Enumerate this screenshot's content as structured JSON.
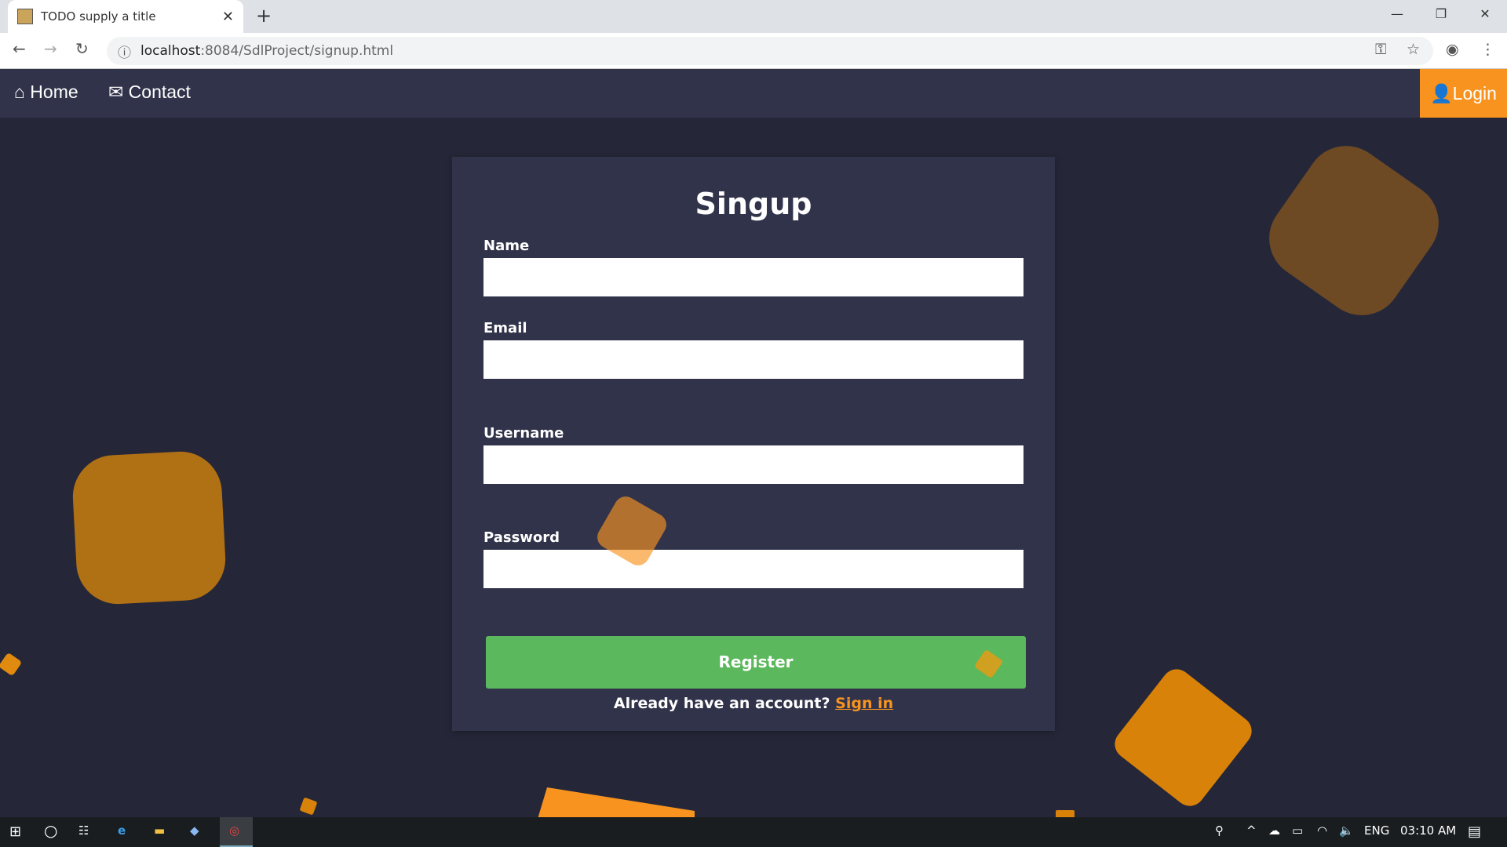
{
  "browser": {
    "tab_title": "TODO supply a title",
    "url_host": "localhost",
    "url_path": ":8084/SdlProject/signup.html"
  },
  "nav": {
    "home": "Home",
    "contact": "Contact",
    "login": "Login"
  },
  "form": {
    "title": "Singup",
    "name_label": "Name",
    "email_label": "Email",
    "username_label": "Username",
    "password_label": "Password",
    "register": "Register",
    "already": "Already have an account? ",
    "signin": "Sign in"
  },
  "taskbar": {
    "lang": "ENG",
    "time": "03:10 AM"
  },
  "colors": {
    "accent": "#f7931e",
    "register": "#5cb85c",
    "card": "#31334a",
    "background": "#252738"
  }
}
